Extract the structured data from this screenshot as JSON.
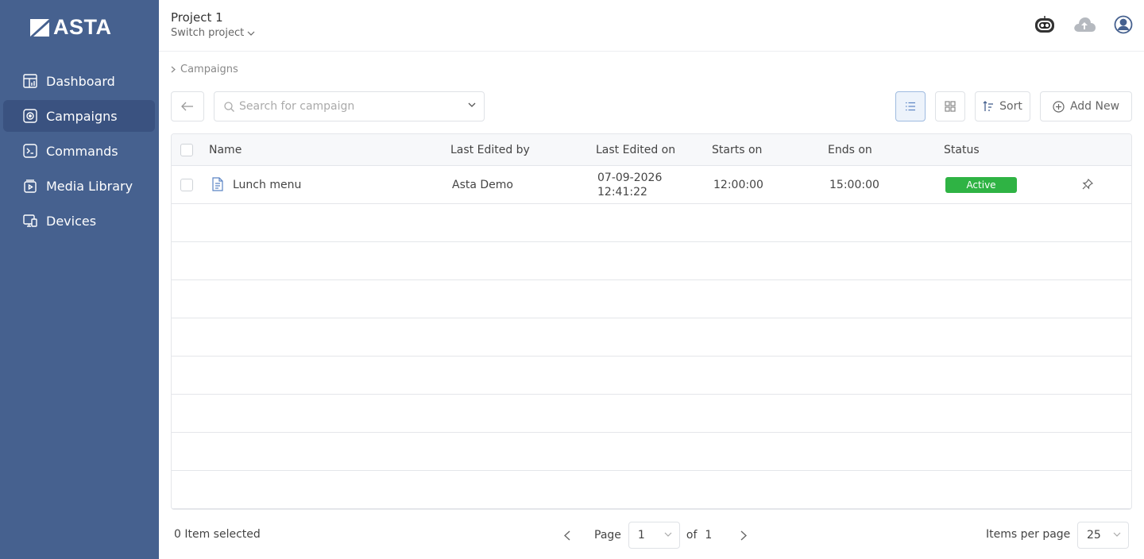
{
  "brand": {
    "name": "ASTA"
  },
  "sidebar": {
    "items": [
      {
        "label": "Dashboard",
        "icon": "dashboard-icon",
        "active": false
      },
      {
        "label": "Campaigns",
        "icon": "campaigns-icon",
        "active": true
      },
      {
        "label": "Commands",
        "icon": "commands-icon",
        "active": false
      },
      {
        "label": "Media Library",
        "icon": "media-library-icon",
        "active": false
      },
      {
        "label": "Devices",
        "icon": "devices-icon",
        "active": false
      }
    ]
  },
  "header": {
    "project_title": "Project 1",
    "switch_project": "Switch project",
    "icons": [
      "robot-icon",
      "cloud-upload-icon",
      "user-icon"
    ]
  },
  "breadcrumb": {
    "items": [
      "Campaigns"
    ]
  },
  "toolbar": {
    "search_placeholder": "Search for campaign",
    "sort_label": "Sort",
    "add_new_label": "Add New",
    "view_mode": "list"
  },
  "table": {
    "columns": [
      "Name",
      "Last Edited by",
      "Last Edited on",
      "Starts on",
      "Ends on",
      "Status"
    ],
    "rows": [
      {
        "name": "Lunch menu",
        "last_edited_by": "Asta Demo",
        "last_edited_on_date": "07-09-2026",
        "last_edited_on_time": "12:41:22",
        "starts_on": "12:00:00",
        "ends_on": "15:00:00",
        "status": "Active"
      }
    ]
  },
  "footer": {
    "selected_text": "0 Item selected",
    "page_label": "Page",
    "page_value": "1",
    "of_label": "of",
    "total_pages": "1",
    "items_per_page_label": "Items per page",
    "items_per_page_value": "25"
  },
  "colors": {
    "sidebar": "#46618f",
    "sidebar_active": "#3a5280",
    "status_active": "#2fb344",
    "accent": "#9fbbe0"
  }
}
